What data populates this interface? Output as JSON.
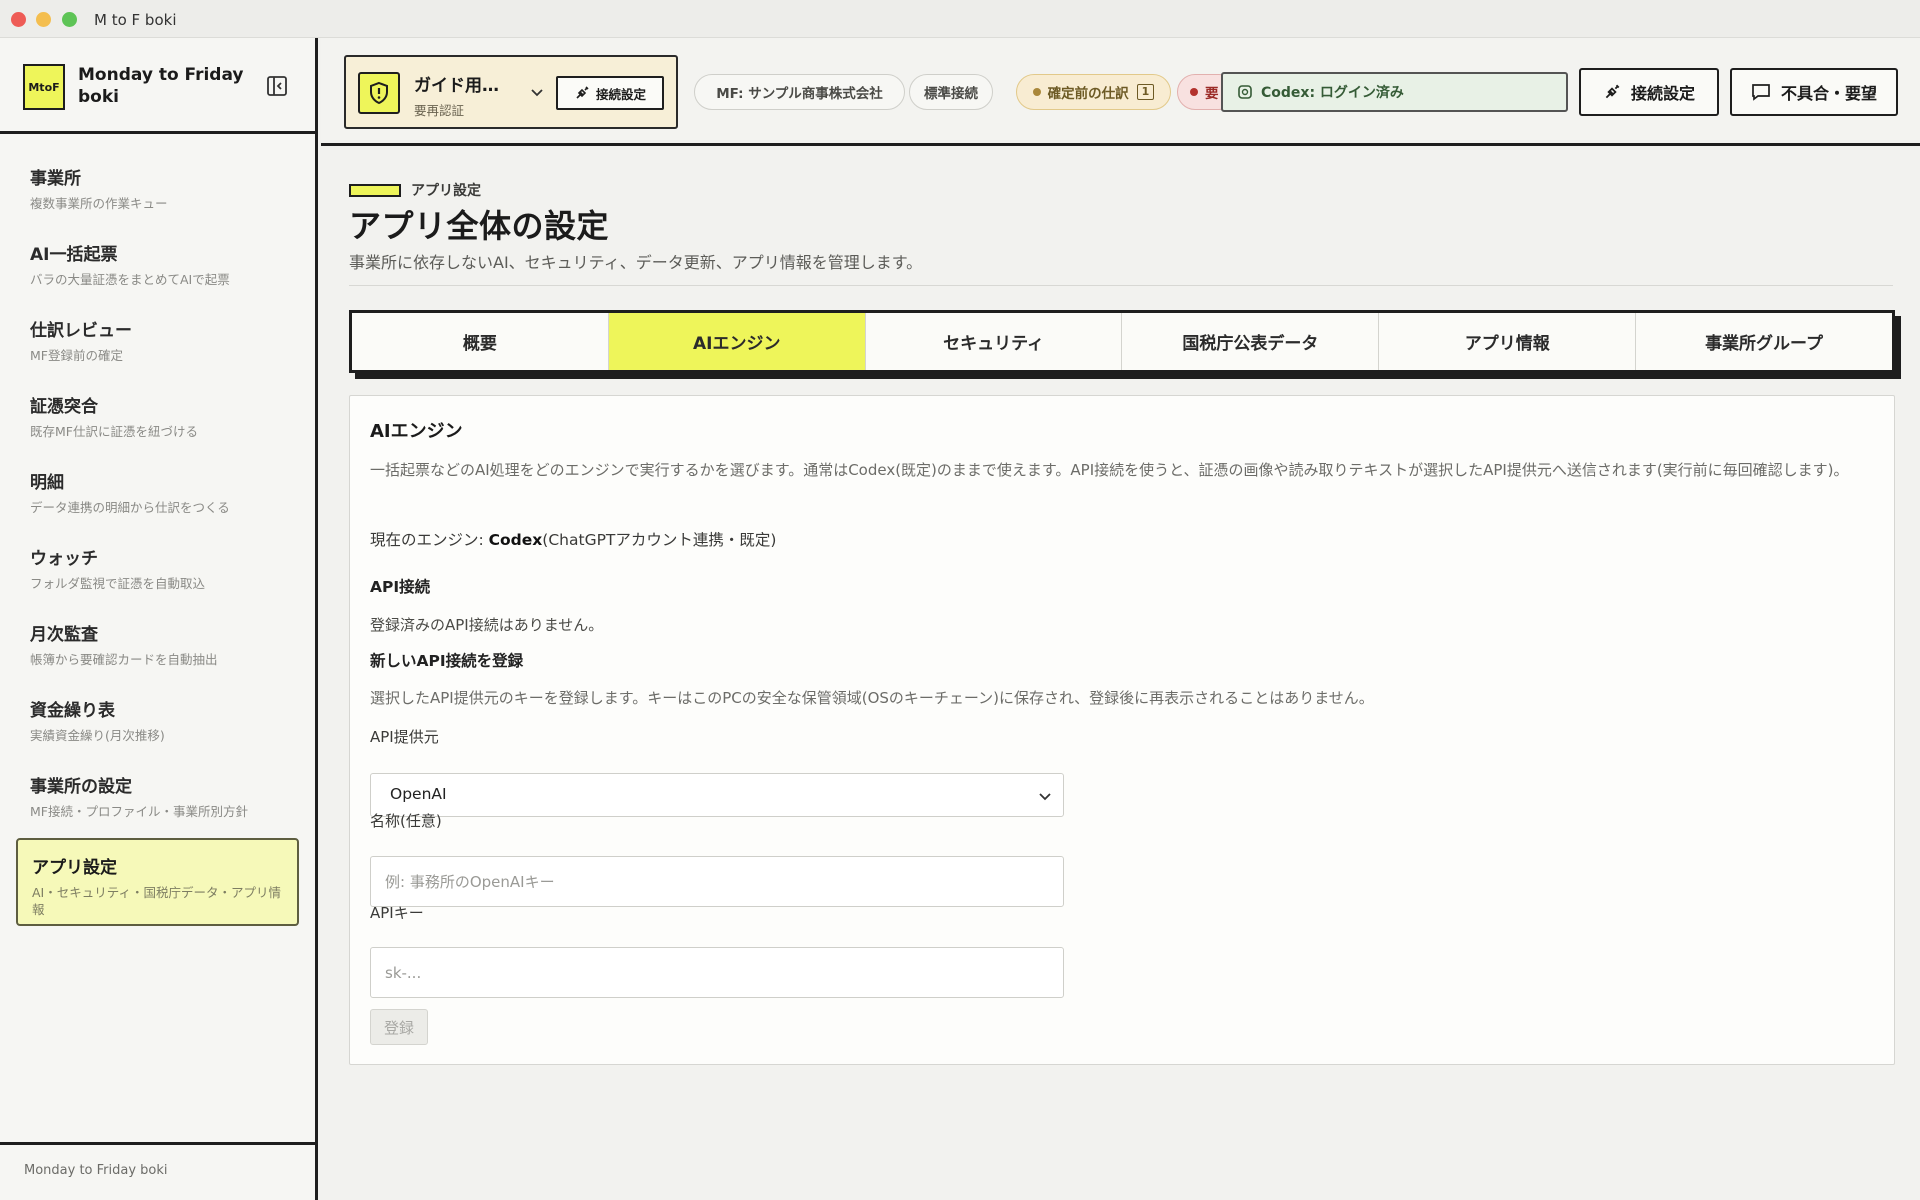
{
  "window": {
    "title": "M to F boki"
  },
  "brand": {
    "logo_text": "MtoF",
    "name": "Monday to Friday boki"
  },
  "sidebar": {
    "items": [
      {
        "label": "事業所",
        "desc": "複数事業所の作業キュー"
      },
      {
        "label": "AI一括起票",
        "desc": "バラの大量証憑をまとめてAIで起票"
      },
      {
        "label": "仕訳レビュー",
        "desc": "MF登録前の確定"
      },
      {
        "label": "証憑突合",
        "desc": "既存MF仕訳に証憑を紐づける"
      },
      {
        "label": "明細",
        "desc": "データ連携の明細から仕訳をつくる"
      },
      {
        "label": "ウォッチ",
        "desc": "フォルダ監視で証憑を自動取込"
      },
      {
        "label": "月次監査",
        "desc": "帳簿から要確認カードを自動抽出"
      },
      {
        "label": "資金繰り表",
        "desc": "実績資金繰り(月次推移)"
      },
      {
        "label": "事業所の設定",
        "desc": "MF接続・プロファイル・事業所別方針"
      },
      {
        "label": "アプリ設定",
        "desc": "AI・セキュリティ・国税庁データ・アプリ情報",
        "active": true
      }
    ],
    "footer": "Monday to Friday boki"
  },
  "header": {
    "guide": {
      "title": "ガイド用…",
      "subtitle": "要再認証",
      "connect_label": "接続設定"
    },
    "company_pill": "MF: サンプル商事株式会社",
    "standard_pill": "標準接続",
    "pending_pill": {
      "label": "確定前の仕訳",
      "count": "1"
    },
    "alert_pill": "要",
    "codex_status": "Codex: ログイン済み",
    "connect_button": "接続設定",
    "report_button": "不具合・要望"
  },
  "page": {
    "eyebrow": "アプリ設定",
    "title": "アプリ全体の設定",
    "description": "事業所に依存しないAI、セキュリティ、データ更新、アプリ情報を管理します。",
    "tabs": [
      {
        "label": "概要"
      },
      {
        "label": "AIエンジン",
        "active": true
      },
      {
        "label": "セキュリティ"
      },
      {
        "label": "国税庁公表データ"
      },
      {
        "label": "アプリ情報"
      },
      {
        "label": "事業所グループ"
      }
    ]
  },
  "ai_engine": {
    "title": "AIエンジン",
    "description": "一括起票などのAI処理をどのエンジンで実行するかを選びます。通常はCodex(既定)のままで使えます。API接続を使うと、証憑の画像や読み取りテキストが選択したAPI提供元へ送信されます(実行前に毎回確認します)。",
    "current_prefix": "現在のエンジン: ",
    "current_engine": "Codex",
    "current_suffix": "(ChatGPTアカウント連携・既定)",
    "api_section_title": "API接続",
    "api_none_text": "登録済みのAPI接続はありません。",
    "register_title": "新しいAPI接続を登録",
    "register_desc": "選択したAPI提供元のキーを登録します。キーはこのPCの安全な保管領域(OSのキーチェーン)に保存され、登録後に再表示されることはありません。",
    "provider_label": "API提供元",
    "provider_value": "OpenAI",
    "name_label": "名称(任意)",
    "name_placeholder": "例: 事務所のOpenAIキー",
    "key_label": "APIキー",
    "key_placeholder": "sk-...",
    "submit_label": "登録"
  },
  "colors": {
    "accent": "#eef55a",
    "border": "#1e1e1e",
    "codex_bg": "#e8f1e6",
    "pending_bg": "#f8ecd2",
    "alert_bg": "#f8e1e0"
  }
}
